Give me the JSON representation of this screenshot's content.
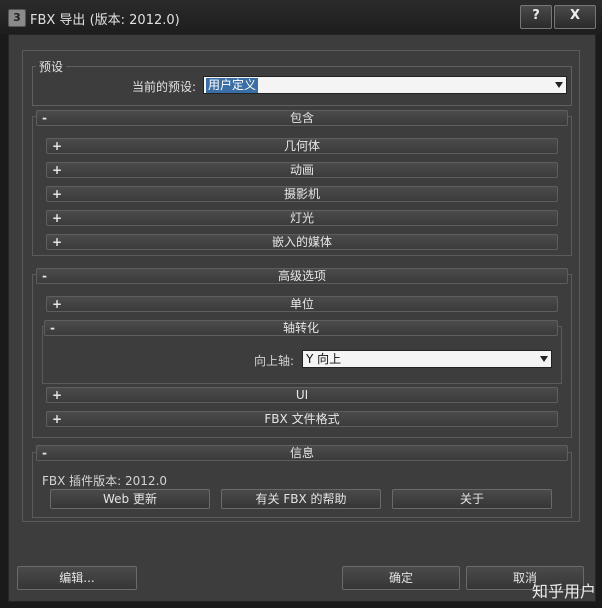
{
  "window": {
    "title": "FBX 导出 (版本: 2012.0)",
    "help_label": "?",
    "close_label": "X"
  },
  "preset": {
    "group_label": "预设",
    "current_label": "当前的预设:",
    "current_value": "用户定义"
  },
  "include": {
    "header": "包含",
    "items": [
      {
        "sign": "+",
        "label": "几何体"
      },
      {
        "sign": "+",
        "label": "动画"
      },
      {
        "sign": "+",
        "label": "摄影机"
      },
      {
        "sign": "+",
        "label": "灯光"
      },
      {
        "sign": "+",
        "label": "嵌入的媒体"
      }
    ]
  },
  "advanced": {
    "header": "高级选项",
    "units": {
      "sign": "+",
      "label": "单位"
    },
    "axis": {
      "sign": "-",
      "label": "轴转化",
      "up_axis_label": "向上轴:",
      "up_axis_value": "Y 向上"
    },
    "ui": {
      "sign": "+",
      "label": "UI"
    },
    "file_format": {
      "sign": "+",
      "label": "FBX 文件格式"
    }
  },
  "info": {
    "header": "信息",
    "plugin_version": "FBX 插件版本: 2012.0",
    "web_update": "Web 更新",
    "help_about_fbx": "有关 FBX 的帮助",
    "about": "关于"
  },
  "footer": {
    "edit": "编辑...",
    "ok": "确定",
    "cancel": "取消"
  },
  "watermark": "知乎用户",
  "header_sign_minus": "-"
}
